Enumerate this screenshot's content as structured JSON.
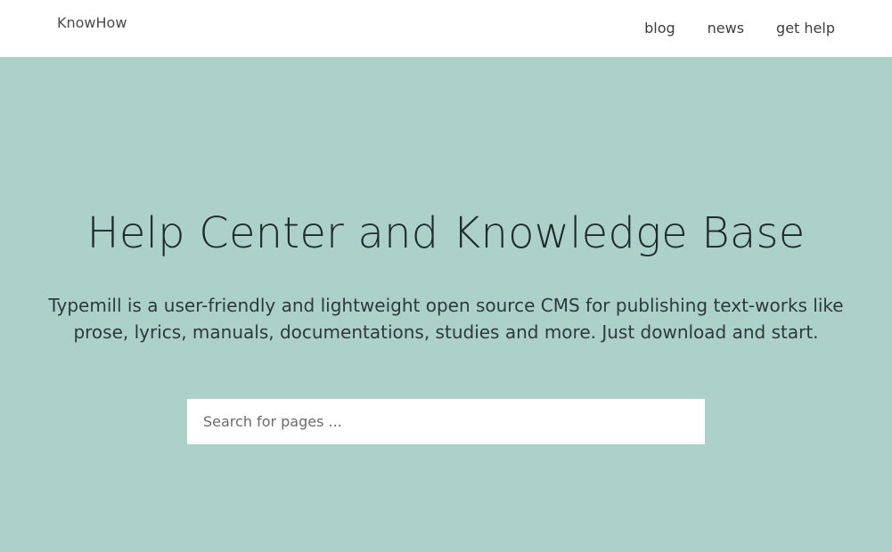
{
  "header": {
    "brand": "KnowHow",
    "nav": [
      {
        "label": "blog"
      },
      {
        "label": "news"
      },
      {
        "label": "get help"
      }
    ]
  },
  "hero": {
    "title": "Help Center and Knowledge Base",
    "subtitle": "Typemill is a user-friendly and lightweight open source CMS for publishing text-works like prose, lyrics, manuals, documentations, studies and more. Just download and start.",
    "search": {
      "placeholder": "Search for pages ..."
    }
  },
  "colors": {
    "hero_bg": "#acd1c9",
    "header_bg": "#ffffff"
  }
}
